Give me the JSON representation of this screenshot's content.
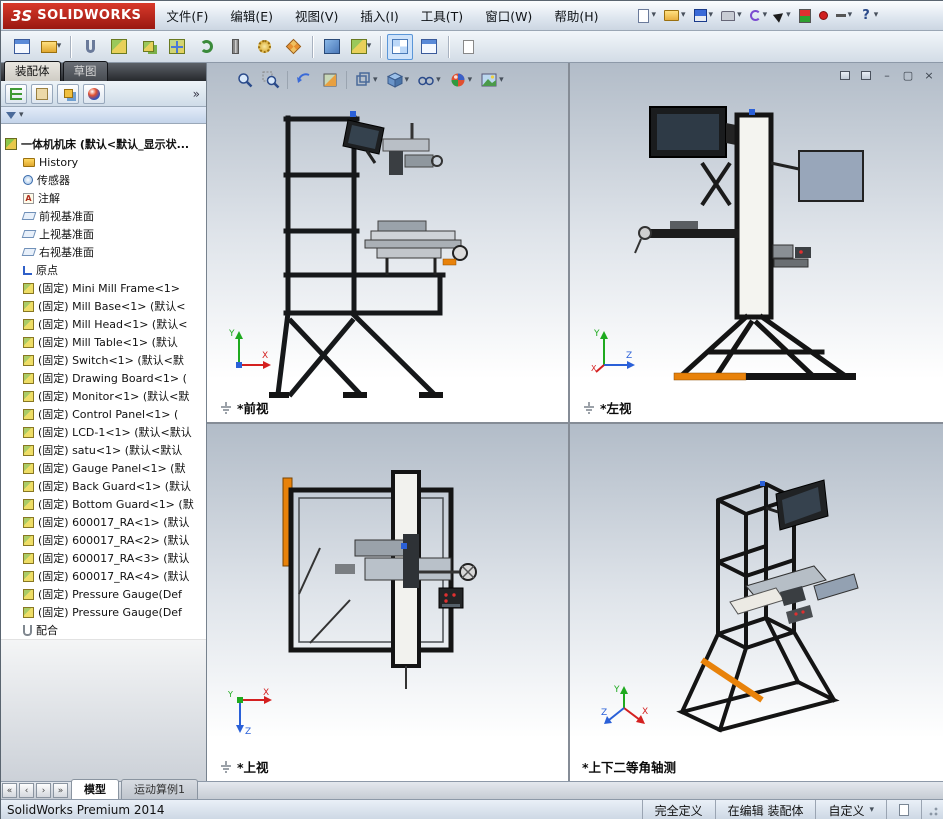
{
  "app": {
    "logo_prefix": "3S",
    "logo_text": "SOLIDWORKS"
  },
  "menubar": {
    "items": [
      "文件(F)",
      "编辑(E)",
      "视图(V)",
      "插入(I)",
      "工具(T)",
      "窗口(W)",
      "帮助(H)"
    ]
  },
  "panel": {
    "tabs": [
      "装配体",
      "草图"
    ],
    "tree": {
      "root": "一体机机床 (默认<默认_显示状...",
      "items": [
        {
          "icon": "history-folder",
          "label": "History"
        },
        {
          "icon": "sensors",
          "label": "传感器"
        },
        {
          "icon": "annotations",
          "label": "注解"
        },
        {
          "icon": "plane",
          "label": "前视基准面"
        },
        {
          "icon": "plane",
          "label": "上视基准面"
        },
        {
          "icon": "plane",
          "label": "右视基准面"
        },
        {
          "icon": "origin",
          "label": "原点"
        },
        {
          "icon": "component",
          "label": "(固定) Mini Mill Frame<1>"
        },
        {
          "icon": "component",
          "label": "(固定) Mill Base<1> (默认<"
        },
        {
          "icon": "component",
          "label": "(固定) Mill Head<1> (默认<"
        },
        {
          "icon": "component",
          "label": "(固定) Mill Table<1> (默认"
        },
        {
          "icon": "component",
          "label": "(固定) Switch<1> (默认<默"
        },
        {
          "icon": "component",
          "label": "(固定) Drawing Board<1> ("
        },
        {
          "icon": "component",
          "label": "(固定) Monitor<1> (默认<默"
        },
        {
          "icon": "component",
          "label": "(固定) Control Panel<1> ("
        },
        {
          "icon": "component",
          "label": "(固定) LCD-1<1> (默认<默认"
        },
        {
          "icon": "component",
          "label": "(固定) satu<1> (默认<默认"
        },
        {
          "icon": "component",
          "label": "(固定) Gauge Panel<1> (默"
        },
        {
          "icon": "component",
          "label": "(固定) Back Guard<1> (默认"
        },
        {
          "icon": "component",
          "label": "(固定) Bottom Guard<1> (默"
        },
        {
          "icon": "component",
          "label": "(固定) 600017_RA<1> (默认"
        },
        {
          "icon": "component",
          "label": "(固定) 600017_RA<2> (默认"
        },
        {
          "icon": "component",
          "label": "(固定) 600017_RA<3> (默认"
        },
        {
          "icon": "component",
          "label": "(固定) 600017_RA<4> (默认"
        },
        {
          "icon": "component",
          "label": "(固定) Pressure Gauge(Def"
        },
        {
          "icon": "component",
          "label": "(固定) Pressure Gauge(Def"
        },
        {
          "icon": "mates",
          "label": "配合"
        }
      ]
    }
  },
  "viewports": {
    "front": {
      "label": "*前视"
    },
    "left": {
      "label": "*左视"
    },
    "top": {
      "label": "*上视"
    },
    "iso": {
      "label": "*上下二等角轴测"
    }
  },
  "axes": {
    "x": "X",
    "y": "Y",
    "z": "Z"
  },
  "bottom_tabs": {
    "model": "模型",
    "motion": "运动算例1"
  },
  "statusbar": {
    "left": "SolidWorks Premium 2014",
    "define": "完全定义",
    "editing": "在编辑 装配体",
    "custom": "自定义"
  },
  "icons": {
    "dropdown": "▾",
    "overflow": "»",
    "minimize": "–",
    "restore": "▢",
    "close": "×",
    "nav_first": "«",
    "nav_prev": "‹",
    "nav_next": "›",
    "nav_last": "»",
    "help": "?",
    "annotation_glyph": "A"
  }
}
